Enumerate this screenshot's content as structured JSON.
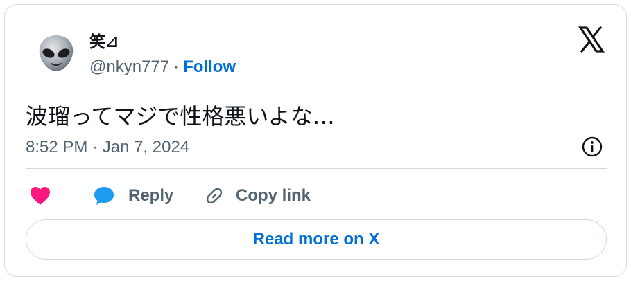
{
  "author": {
    "display_name": "笑⊿",
    "handle": "@nkyn777",
    "separator": "·",
    "follow_label": "Follow",
    "avatar_icon": "alien-emoji-avatar"
  },
  "tweet": {
    "text": "波瑠ってマジで性格悪いよな…",
    "timestamp": "8:52 PM · Jan 7, 2024"
  },
  "actions": {
    "like_icon": "heart-icon",
    "reply_label": "Reply",
    "copy_link_label": "Copy link"
  },
  "footer": {
    "read_more_label": "Read more on X"
  },
  "colors": {
    "accent_blue": "#006fd6",
    "like_pink": "#f91880",
    "reply_blue": "#1d9bf0",
    "muted_text": "#536471",
    "text": "#0f1419",
    "border": "#cfd9de"
  }
}
